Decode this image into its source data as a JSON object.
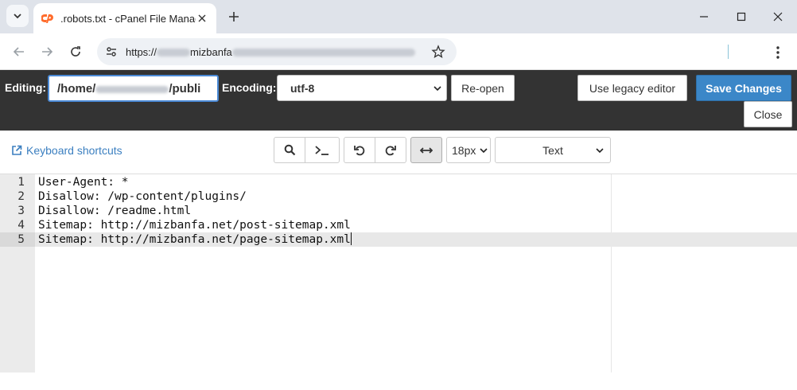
{
  "browser": {
    "tab_title": ".robots.txt - cPanel File Manage",
    "url_prefix": "https://",
    "url_domain": "mizbanfa",
    "colors": {
      "tab_strip": "#dfe3ea",
      "omnibox": "#eef1f5",
      "cpanel_orange": "#ff6c2c"
    }
  },
  "editor_header": {
    "editing_label": "Editing:",
    "path_start": "/home/",
    "path_end": "/publi",
    "encoding_label": "Encoding:",
    "encoding_value": "utf-8",
    "reopen_label": "Re-open",
    "legacy_label": "Use legacy editor",
    "save_label": "Save Changes",
    "close_label": "Close",
    "colors": {
      "header_bg": "#333333",
      "save_bg": "#3b87c8"
    }
  },
  "toolbar": {
    "keyboard_shortcuts": "Keyboard shortcuts",
    "font_size": "18px",
    "mode": "Text",
    "icons": [
      "search-icon",
      "terminal-icon",
      "undo-icon",
      "redo-icon",
      "wrap-icon"
    ]
  },
  "code": {
    "lines": [
      {
        "n": "1",
        "text": "User-Agent: *"
      },
      {
        "n": "2",
        "text": "Disallow: /wp-content/plugins/"
      },
      {
        "n": "3",
        "text": "Disallow: /readme.html"
      },
      {
        "n": "4",
        "text": "Sitemap: http://mizbanfa.net/post-sitemap.xml"
      },
      {
        "n": "5",
        "text": "Sitemap: http://mizbanfa.net/page-sitemap.xml"
      }
    ],
    "active_line": 5
  }
}
